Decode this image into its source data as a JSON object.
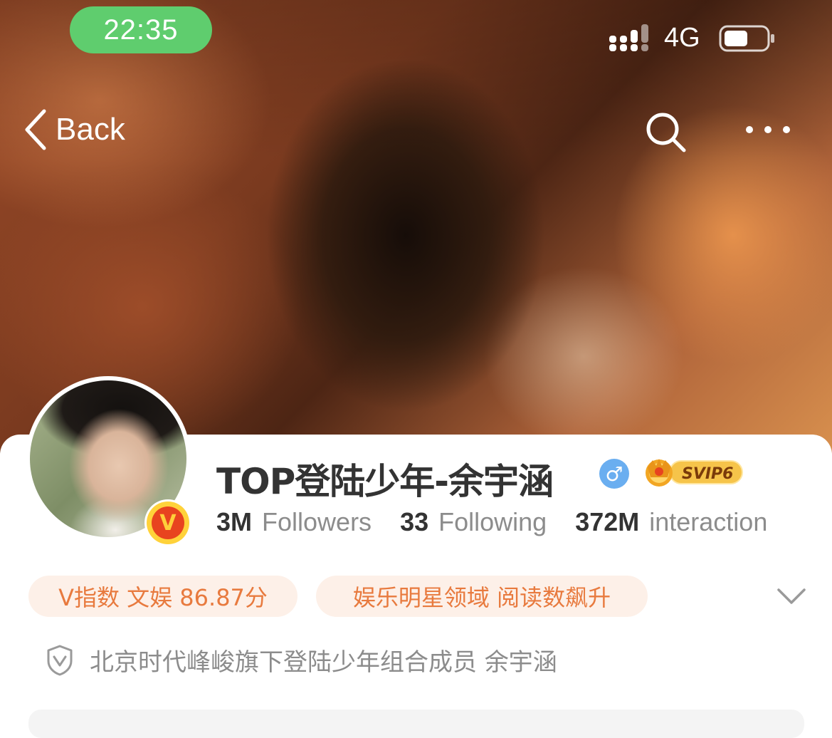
{
  "status_bar": {
    "time": "22:35",
    "network": "4G"
  },
  "nav": {
    "back_label": "Back"
  },
  "profile": {
    "name": "TOP登陆少年-余宇涵",
    "gender_symbol": "♂",
    "verified_badge": "V",
    "vip_label": "SVIP6",
    "stats": [
      {
        "value": "3M",
        "label": "Followers"
      },
      {
        "value": "33",
        "label": "Following"
      },
      {
        "value": "372M",
        "label": "interaction"
      }
    ],
    "tags": [
      "V指数 文娱 86.87分",
      "娱乐明星领域 阅读数飙升"
    ],
    "verification_text": "北京时代峰峻旗下登陆少年组合成员 余宇涵"
  },
  "colors": {
    "time_pill": "#5fcd6e",
    "tag_bg": "#fdf0e8",
    "tag_text": "#e87a3e",
    "gender_badge": "#6aaef0",
    "verified_badge": "#e8431f"
  },
  "icons": {
    "back": "chevron-left-icon",
    "search": "search-icon",
    "more": "more-dots-icon",
    "signal": "signal-icon",
    "battery": "battery-icon",
    "expand": "chevron-down-icon",
    "verify": "shield-v-icon"
  }
}
